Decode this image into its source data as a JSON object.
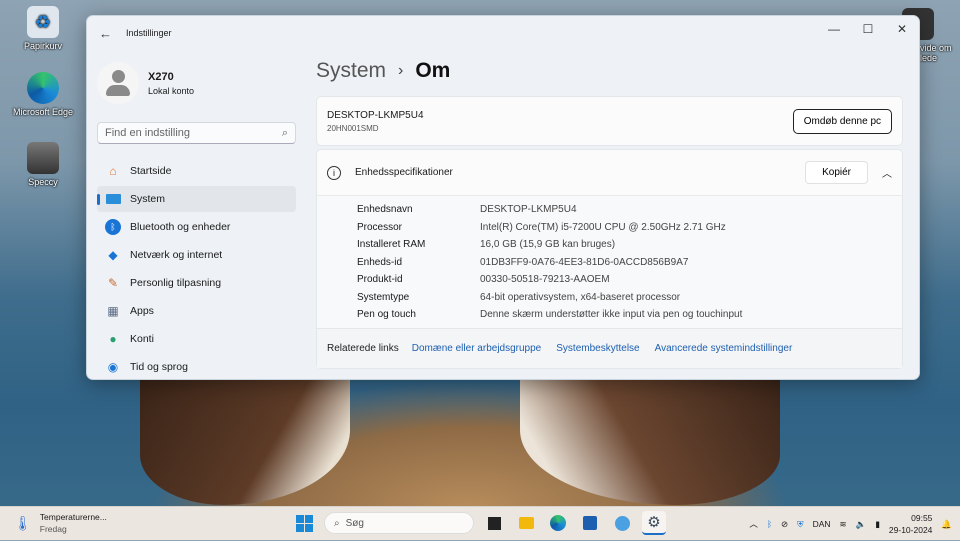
{
  "desktop": {
    "icons": [
      {
        "label": "Papirkurv",
        "icon": "recycle-bin-icon"
      },
      {
        "label": "Microsoft Edge",
        "icon": "edge-icon"
      },
      {
        "label": "Speccy",
        "icon": "speccy-icon"
      },
      {
        "label": "vide om\nlede",
        "icon": "learn-about-picture-icon"
      }
    ]
  },
  "window": {
    "title": "Indstillinger",
    "controls": [
      "minimize",
      "maximize",
      "close"
    ]
  },
  "sidebar": {
    "user": {
      "name": "X270",
      "type": "Lokal konto"
    },
    "search_placeholder": "Find en indstilling",
    "items": [
      {
        "label": "Startside",
        "icon": "home-icon"
      },
      {
        "label": "System",
        "icon": "system-icon",
        "selected": true
      },
      {
        "label": "Bluetooth og enheder",
        "icon": "bluetooth-icon"
      },
      {
        "label": "Netværk og internet",
        "icon": "wifi-icon"
      },
      {
        "label": "Personlig tilpasning",
        "icon": "brush-icon"
      },
      {
        "label": "Apps",
        "icon": "apps-icon"
      },
      {
        "label": "Konti",
        "icon": "account-icon"
      },
      {
        "label": "Tid og sprog",
        "icon": "globe-clock-icon"
      }
    ]
  },
  "main": {
    "breadcrumb": {
      "parent": "System",
      "current": "Om"
    },
    "pc": {
      "name": "DESKTOP-LKMP5U4",
      "model": "20HN001SMD",
      "rename_label": "Omdøb denne pc"
    },
    "specs": {
      "title": "Enhedsspecifikationer",
      "copy_label": "Kopiér",
      "rows": [
        {
          "k": "Enhedsnavn",
          "v": "DESKTOP-LKMP5U4"
        },
        {
          "k": "Processor",
          "v": "Intel(R) Core(TM) i5-7200U CPU @ 2.50GHz   2.71 GHz"
        },
        {
          "k": "Installeret RAM",
          "v": "16,0 GB (15,9 GB kan bruges)"
        },
        {
          "k": "Enheds-id",
          "v": "01DB3FF9-0A76-4EE3-81D6-0ACCD856B9A7"
        },
        {
          "k": "Produkt-id",
          "v": "00330-50518-79213-AAOEM"
        },
        {
          "k": "Systemtype",
          "v": "64-bit operativsystem, x64-baseret processor"
        },
        {
          "k": "Pen og touch",
          "v": "Denne skærm understøtter ikke input via pen og touchinput"
        }
      ]
    },
    "related": {
      "label": "Relaterede links",
      "links": [
        "Domæne eller arbejdsgruppe",
        "Systembeskyttelse",
        "Avancerede systemindstillinger"
      ]
    }
  },
  "taskbar": {
    "weather": {
      "title": "Temperaturerne...",
      "sub": "Fredag"
    },
    "search_placeholder": "Søg",
    "language": "DAN",
    "time": "09:55",
    "date": "29-10-2024"
  },
  "colors": {
    "accent": "#1a6fc9",
    "link": "#1d5fb0"
  }
}
